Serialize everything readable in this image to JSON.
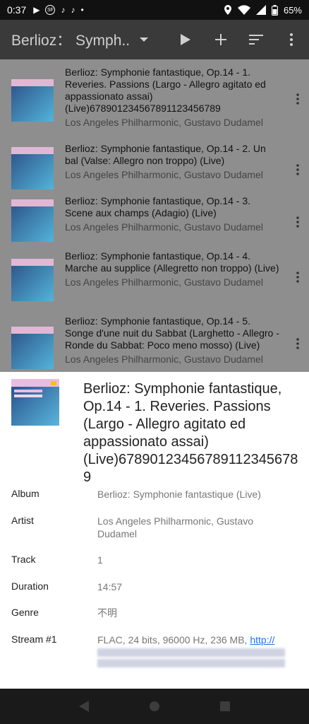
{
  "status_bar": {
    "time": "0:37",
    "battery": "65%",
    "notif_icons": [
      "play-icon",
      "sf-icon",
      "tiktok-icon",
      "tiktok-icon",
      "dot-icon"
    ]
  },
  "app_bar": {
    "title": "Berlioz： Symph..",
    "actions": [
      "play-icon",
      "add-icon",
      "sort-icon",
      "more-vert-icon"
    ]
  },
  "tracks": [
    {
      "title": "Berlioz: Symphonie fantastique, Op.14 - 1. Reveries. Passions (Largo - Allegro agitato ed appassionato assai) (Live)67890123456789112345678​9",
      "artist": "Los Angeles Philharmonic, Gustavo Dudamel"
    },
    {
      "title": "Berlioz: Symphonie fantastique, Op.14 - 2. Un bal (Valse: Allegro non troppo) (Live)",
      "artist": "Los Angeles Philharmonic, Gustavo Dudamel"
    },
    {
      "title": "Berlioz: Symphonie fantastique, Op.14 - 3. Scene aux champs (Adagio) (Live)",
      "artist": "Los Angeles Philharmonic, Gustavo Dudamel"
    },
    {
      "title": "Berlioz: Symphonie fantastique, Op.14 - 4. Marche au supplice (Allegretto non troppo) (Live)",
      "artist": "Los Angeles Philharmonic, Gustavo Dudamel"
    },
    {
      "title": "Berlioz: Symphonie fantastique, Op.14 - 5. Songe d'une nuit du Sabbat (Larghetto - Allegro - Ronde du Sabbat: Poco meno mosso) (Live)",
      "artist": "Los Angeles Philharmonic, Gustavo Dudamel"
    }
  ],
  "details": {
    "title": "Berlioz: Symphonie fantastique, Op.14 - 1. Reveries. Passions (Largo - Allegro agitato ed appassionato assai) (Live)67890123456789112345678​9",
    "fields": [
      {
        "label": "Album",
        "value": "Berlioz: Symphonie fantastique (Live)"
      },
      {
        "label": "Artist",
        "value": "Los Angeles Philharmonic, Gustavo Dudamel"
      },
      {
        "label": "Track",
        "value": "1"
      },
      {
        "label": "Duration",
        "value": "14:57"
      },
      {
        "label": "Genre",
        "value": "不明"
      },
      {
        "label": "Stream #1",
        "value": "FLAC, 24 bits, 96000 Hz, 236 MB,",
        "link": "http://"
      }
    ]
  },
  "nav_bar": [
    "back-icon",
    "home-icon",
    "recents-icon"
  ]
}
